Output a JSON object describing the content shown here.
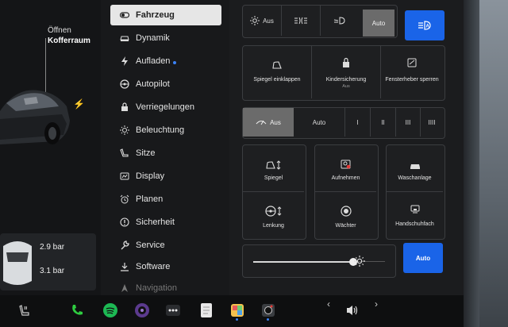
{
  "car_panel": {
    "trunk_line1": "Öffnen",
    "trunk_line2": "Kofferraum",
    "tire_front": "2.9 bar",
    "tire_rear": "3.1 bar"
  },
  "nav": {
    "items": [
      {
        "label": "Fahrzeug",
        "icon": "toggle-icon",
        "active": true
      },
      {
        "label": "Dynamik",
        "icon": "car-icon"
      },
      {
        "label": "Aufladen",
        "icon": "bolt-icon",
        "badge": true
      },
      {
        "label": "Autopilot",
        "icon": "steering-wheel-icon"
      },
      {
        "label": "Verriegelungen",
        "icon": "lock-icon"
      },
      {
        "label": "Beleuchtung",
        "icon": "sun-icon"
      },
      {
        "label": "Sitze",
        "icon": "seat-icon"
      },
      {
        "label": "Display",
        "icon": "display-icon"
      },
      {
        "label": "Planen",
        "icon": "alarm-clock-icon"
      },
      {
        "label": "Sicherheit",
        "icon": "alert-circle-icon"
      },
      {
        "label": "Service",
        "icon": "wrench-icon"
      },
      {
        "label": "Software",
        "icon": "download-icon"
      },
      {
        "label": "Navigation",
        "icon": "navigation-icon"
      }
    ]
  },
  "lights": {
    "off_label": "Aus",
    "auto_label": "Auto",
    "active": "Auto"
  },
  "tiles_top": {
    "mirrors": "Spiegel einklappen",
    "child_lock": "Kindersicherung",
    "child_lock_sub": "Aus",
    "windows": "Fensterheber sperren"
  },
  "wipers": {
    "off_label": "Aus",
    "auto_label": "Auto",
    "speeds": [
      "I",
      "II",
      "III",
      "IIII"
    ],
    "active": "Aus"
  },
  "tiles_grid": {
    "mirror": "Spiegel",
    "record": "Aufnehmen",
    "washer": "Waschanlage",
    "steering": "Lenkung",
    "sentry": "Wächter",
    "glovebox": "Handschuhfach"
  },
  "brightness": {
    "level": 0.78,
    "auto_label": "Auto"
  },
  "taskbar": {
    "icons": [
      "seat-heater-icon",
      "phone-icon",
      "spotify-icon",
      "camera-lens-icon",
      "more-apps-icon",
      "notes-icon",
      "toybox-icon",
      "dashcam-icon"
    ],
    "volume_icon": "volume-icon"
  },
  "colors": {
    "accent_blue": "#1a64e8",
    "active_segment": "#6b6b6b",
    "nav_active": "#e6e6e6",
    "phone_green": "#2ecc40",
    "spotify_green": "#1db954"
  }
}
